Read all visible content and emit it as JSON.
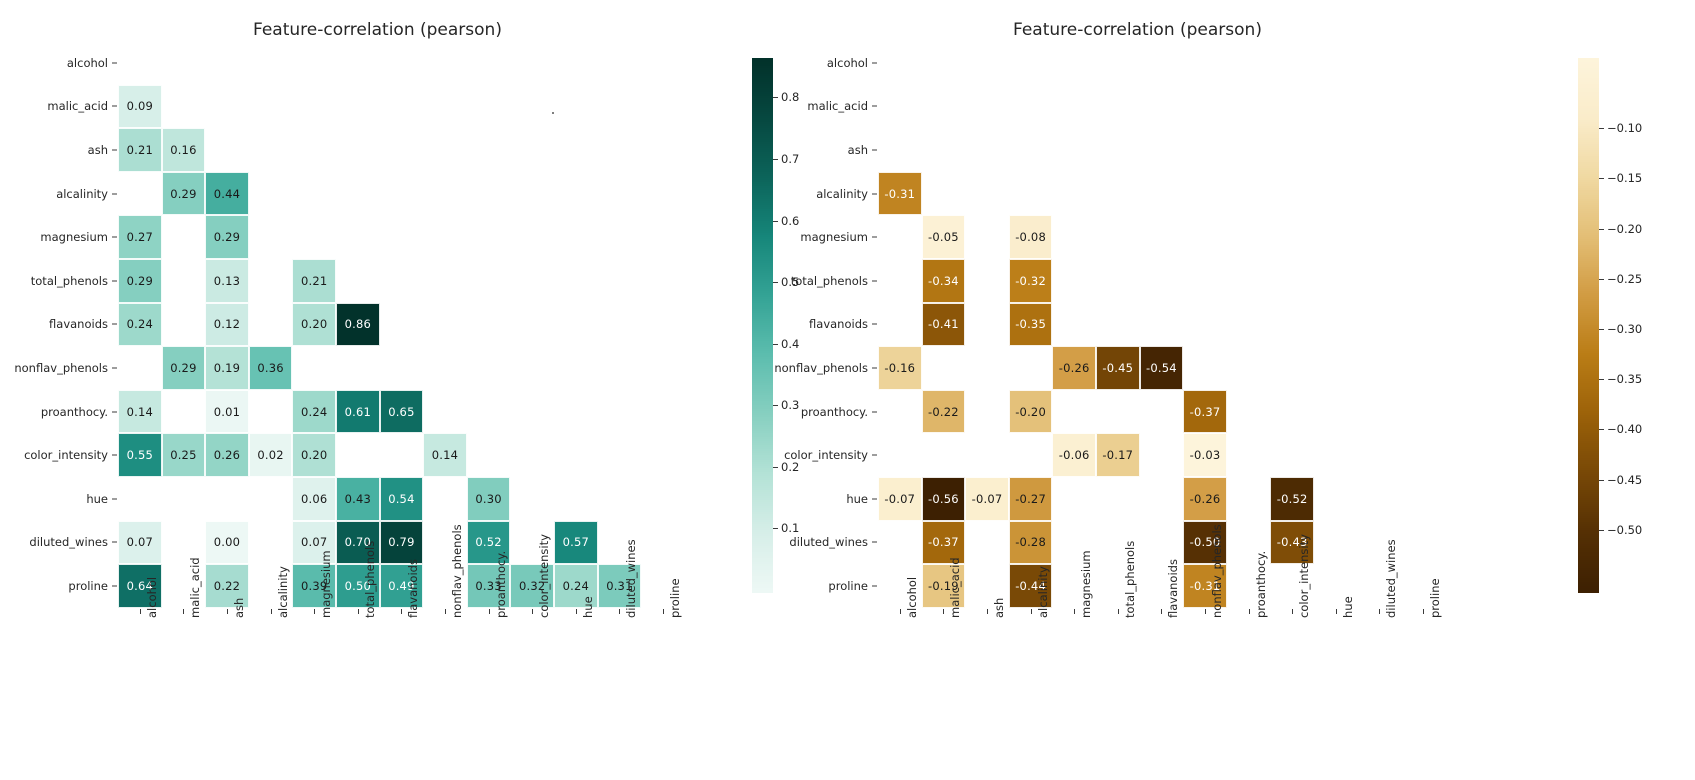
{
  "figure": {
    "background": "#ffffff",
    "text_color": "#262626"
  },
  "panels": [
    {
      "id": "positive-correlations",
      "title": "Feature-correlation (pearson)",
      "cmap": "teal-green (BuGn-like)",
      "colorbar": {
        "ticks": [
          "0.1",
          "0.2",
          "0.3",
          "0.4",
          "0.5",
          "0.6",
          "0.7",
          "0.8"
        ],
        "tick_values": [
          0.1,
          0.2,
          0.3,
          0.4,
          0.5,
          0.6,
          0.7,
          0.8
        ],
        "vmin": 0.0,
        "vmax": 0.864,
        "low_color": "#f0f9f6",
        "high_color": "#00312a"
      }
    },
    {
      "id": "negative-correlations",
      "title": "Feature-correlation (pearson)",
      "cmap": "brown-tan (YlOrBr-like)",
      "colorbar": {
        "ticks": [
          "−0.10",
          "−0.15",
          "−0.20",
          "−0.25",
          "−0.30",
          "−0.35",
          "−0.40",
          "−0.45",
          "−0.50"
        ],
        "tick_values": [
          -0.1,
          -0.15,
          -0.2,
          -0.25,
          -0.3,
          -0.35,
          -0.4,
          -0.45,
          -0.5
        ],
        "vmin": -0.56,
        "vmax": -0.03,
        "low_color": "#3d2000",
        "high_color": "#faefcf"
      }
    }
  ],
  "chart_data": [
    {
      "type": "heatmap",
      "title": "Feature-correlation (pearson)",
      "xlabel": "",
      "ylabel": "",
      "grid": false,
      "legend_position": "right",
      "colorbar_label": "",
      "vmin": 0.0,
      "vmax": 0.864,
      "colorbar_ticks": [
        0.1,
        0.2,
        0.3,
        0.4,
        0.5,
        0.6,
        0.7,
        0.8
      ],
      "xticklabels": [
        "alcohol",
        "malic_acid",
        "ash",
        "alcalinity",
        "magnesium",
        "total_phenols",
        "flavanoids",
        "nonflav_phenols",
        "proanthocy.",
        "color_intensity",
        "hue",
        "diluted_wines",
        "proline"
      ],
      "yticklabels": [
        "alcohol",
        "malic_acid",
        "ash",
        "alcalinity",
        "magnesium",
        "total_phenols",
        "flavanoids",
        "nonflav_phenols",
        "proanthocy.",
        "color_intensity",
        "hue",
        "diluted_wines",
        "proline"
      ],
      "annotations": [
        "0.09",
        "0.21",
        "0.16",
        "0.29",
        "0.44",
        "0.27",
        "0.29",
        "0.29",
        "0.13",
        "0.21",
        "0.24",
        "0.12",
        "0.20",
        "0.86",
        "0.29",
        "0.19",
        "0.36",
        "0.14",
        "0.01",
        "0.24",
        "0.61",
        "0.65",
        "0.55",
        "0.25",
        "0.26",
        "0.02",
        "0.20",
        "0.14",
        "0.06",
        "0.43",
        "0.54",
        "0.30",
        "0.07",
        "0.00",
        "0.07",
        "0.70",
        "0.79",
        "0.52",
        "0.57",
        "0.64",
        "0.22",
        "0.39",
        "0.50",
        "0.49",
        "0.33",
        "0.32",
        "0.24",
        "0.31"
      ],
      "values": [
        [
          null,
          null,
          null,
          null,
          null,
          null,
          null,
          null,
          null,
          null,
          null,
          null,
          null
        ],
        [
          0.09,
          null,
          null,
          null,
          null,
          null,
          null,
          null,
          null,
          null,
          null,
          null,
          null
        ],
        [
          0.21,
          0.16,
          null,
          null,
          null,
          null,
          null,
          null,
          null,
          null,
          null,
          null,
          null
        ],
        [
          null,
          0.29,
          0.44,
          null,
          null,
          null,
          null,
          null,
          null,
          null,
          null,
          null,
          null
        ],
        [
          0.27,
          null,
          0.29,
          null,
          null,
          null,
          null,
          null,
          null,
          null,
          null,
          null,
          null
        ],
        [
          0.29,
          null,
          0.13,
          null,
          0.21,
          null,
          null,
          null,
          null,
          null,
          null,
          null,
          null
        ],
        [
          0.24,
          null,
          0.12,
          null,
          0.2,
          0.86,
          null,
          null,
          null,
          null,
          null,
          null,
          null
        ],
        [
          null,
          0.29,
          0.19,
          0.36,
          null,
          null,
          null,
          null,
          null,
          null,
          null,
          null,
          null
        ],
        [
          0.14,
          null,
          0.01,
          null,
          0.24,
          0.61,
          0.65,
          null,
          null,
          null,
          null,
          null,
          null
        ],
        [
          0.55,
          0.25,
          0.26,
          0.02,
          0.2,
          null,
          null,
          0.14,
          null,
          null,
          null,
          null,
          null
        ],
        [
          null,
          null,
          null,
          null,
          0.06,
          0.43,
          0.54,
          null,
          0.3,
          null,
          null,
          null,
          null
        ],
        [
          0.07,
          null,
          0.0,
          null,
          0.07,
          0.7,
          0.79,
          null,
          0.52,
          null,
          0.57,
          null,
          null
        ],
        [
          0.64,
          null,
          0.22,
          null,
          0.39,
          0.5,
          0.49,
          null,
          0.33,
          0.32,
          0.24,
          0.31,
          null
        ]
      ]
    },
    {
      "type": "heatmap",
      "title": "Feature-correlation (pearson)",
      "xlabel": "",
      "ylabel": "",
      "grid": false,
      "legend_position": "right",
      "colorbar_label": "",
      "vmin": -0.56,
      "vmax": -0.03,
      "colorbar_ticks": [
        -0.1,
        -0.15,
        -0.2,
        -0.25,
        -0.3,
        -0.35,
        -0.4,
        -0.45,
        -0.5
      ],
      "xticklabels": [
        "alcohol",
        "malic_acid",
        "ash",
        "alcalinity",
        "magnesium",
        "total_phenols",
        "flavanoids",
        "nonflav_phenols",
        "proanthocy.",
        "color_intensity",
        "hue",
        "diluted_wines",
        "proline"
      ],
      "yticklabels": [
        "alcohol",
        "malic_acid",
        "ash",
        "alcalinity",
        "magnesium",
        "total_phenols",
        "flavanoids",
        "nonflav_phenols",
        "proanthocy.",
        "color_intensity",
        "hue",
        "diluted_wines",
        "proline"
      ],
      "annotations": [
        "-0.31",
        "-0.05",
        "-0.08",
        "-0.34",
        "-0.32",
        "-0.41",
        "-0.35",
        "-0.16",
        "-0.26",
        "-0.45",
        "-0.54",
        "-0.22",
        "-0.20",
        "-0.37",
        "-0.06",
        "-0.17",
        "-0.03",
        "-0.07",
        "-0.56",
        "-0.07",
        "-0.27",
        "-0.26",
        "-0.52",
        "-0.37",
        "-0.28",
        "-0.50",
        "-0.43",
        "-0.19",
        "-0.44",
        "-0.31"
      ],
      "values": [
        [
          null,
          null,
          null,
          null,
          null,
          null,
          null,
          null,
          null,
          null,
          null,
          null,
          null
        ],
        [
          null,
          null,
          null,
          null,
          null,
          null,
          null,
          null,
          null,
          null,
          null,
          null,
          null
        ],
        [
          null,
          null,
          null,
          null,
          null,
          null,
          null,
          null,
          null,
          null,
          null,
          null,
          null
        ],
        [
          -0.31,
          null,
          null,
          null,
          null,
          null,
          null,
          null,
          null,
          null,
          null,
          null,
          null
        ],
        [
          null,
          -0.05,
          null,
          -0.08,
          null,
          null,
          null,
          null,
          null,
          null,
          null,
          null,
          null
        ],
        [
          null,
          -0.34,
          null,
          -0.32,
          null,
          null,
          null,
          null,
          null,
          null,
          null,
          null,
          null
        ],
        [
          null,
          -0.41,
          null,
          -0.35,
          null,
          null,
          null,
          null,
          null,
          null,
          null,
          null,
          null
        ],
        [
          -0.16,
          null,
          null,
          null,
          -0.26,
          -0.45,
          -0.54,
          null,
          null,
          null,
          null,
          null,
          null
        ],
        [
          null,
          -0.22,
          null,
          -0.2,
          null,
          null,
          null,
          -0.37,
          null,
          null,
          null,
          null,
          null
        ],
        [
          null,
          null,
          null,
          null,
          -0.06,
          -0.17,
          null,
          -0.03,
          null,
          null,
          null,
          null,
          null
        ],
        [
          -0.07,
          -0.56,
          -0.07,
          -0.27,
          null,
          null,
          null,
          -0.26,
          null,
          -0.52,
          null,
          null,
          null
        ],
        [
          null,
          -0.37,
          null,
          -0.28,
          null,
          null,
          null,
          -0.5,
          null,
          -0.43,
          null,
          null,
          null
        ],
        [
          null,
          -0.19,
          null,
          -0.44,
          null,
          null,
          null,
          -0.31,
          null,
          null,
          null,
          null,
          null
        ]
      ]
    }
  ]
}
